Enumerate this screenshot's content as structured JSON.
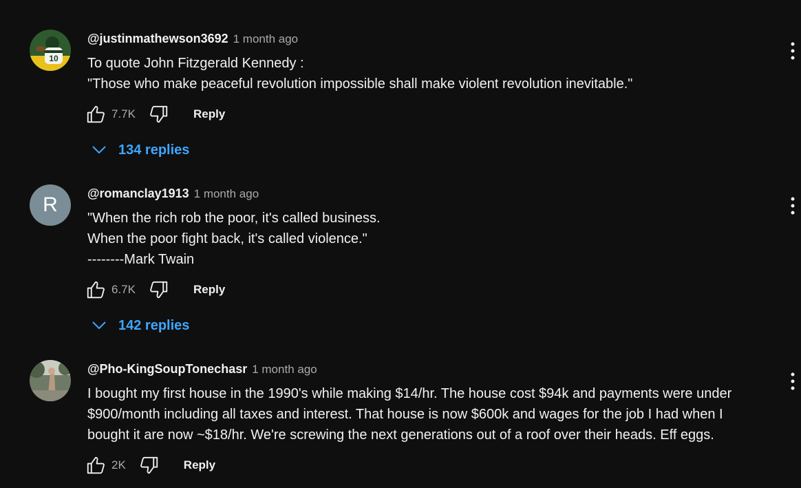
{
  "comments": [
    {
      "author": "@justinmathewson3692",
      "time": "1 month ago",
      "lines": [
        "To quote John Fitzgerald Kennedy :",
        "\"Those who make peaceful revolution impossible shall make violent revolution inevitable.\""
      ],
      "likes": "7.7K",
      "reply_label": "Reply",
      "replies_label": "134 replies",
      "avatar_jersey": "10"
    },
    {
      "author": "@romanclay1913",
      "time": "1 month ago",
      "lines": [
        "\"When the rich rob the poor, it's called business.",
        "When the poor fight back, it's called violence.\"",
        "--------Mark Twain"
      ],
      "likes": "6.7K",
      "reply_label": "Reply",
      "replies_label": "142 replies",
      "avatar_letter": "R"
    },
    {
      "author": "@Pho-KingSoupTonechasr",
      "time": "1 month ago",
      "lines": [
        "I bought my first house in the 1990's while making $14/hr. The house cost $94k and payments were under",
        "$900/month including all taxes and interest. That house is now $600k and wages for the job I had when I",
        "bought it are now ~$18/hr. We're screwing the next generations out of a roof over their heads. Eff eggs."
      ],
      "likes": "2K",
      "reply_label": "Reply"
    }
  ],
  "colors": {
    "background": "#0f0f0f",
    "text": "#f1f1f1",
    "secondary_text": "#aaaaaa",
    "link": "#3ea6ff",
    "avatar_letter_bg": "#7b8d96"
  },
  "icons": [
    "thumbs-up-icon",
    "thumbs-down-icon",
    "chevron-down-icon",
    "more-vert-icon"
  ]
}
